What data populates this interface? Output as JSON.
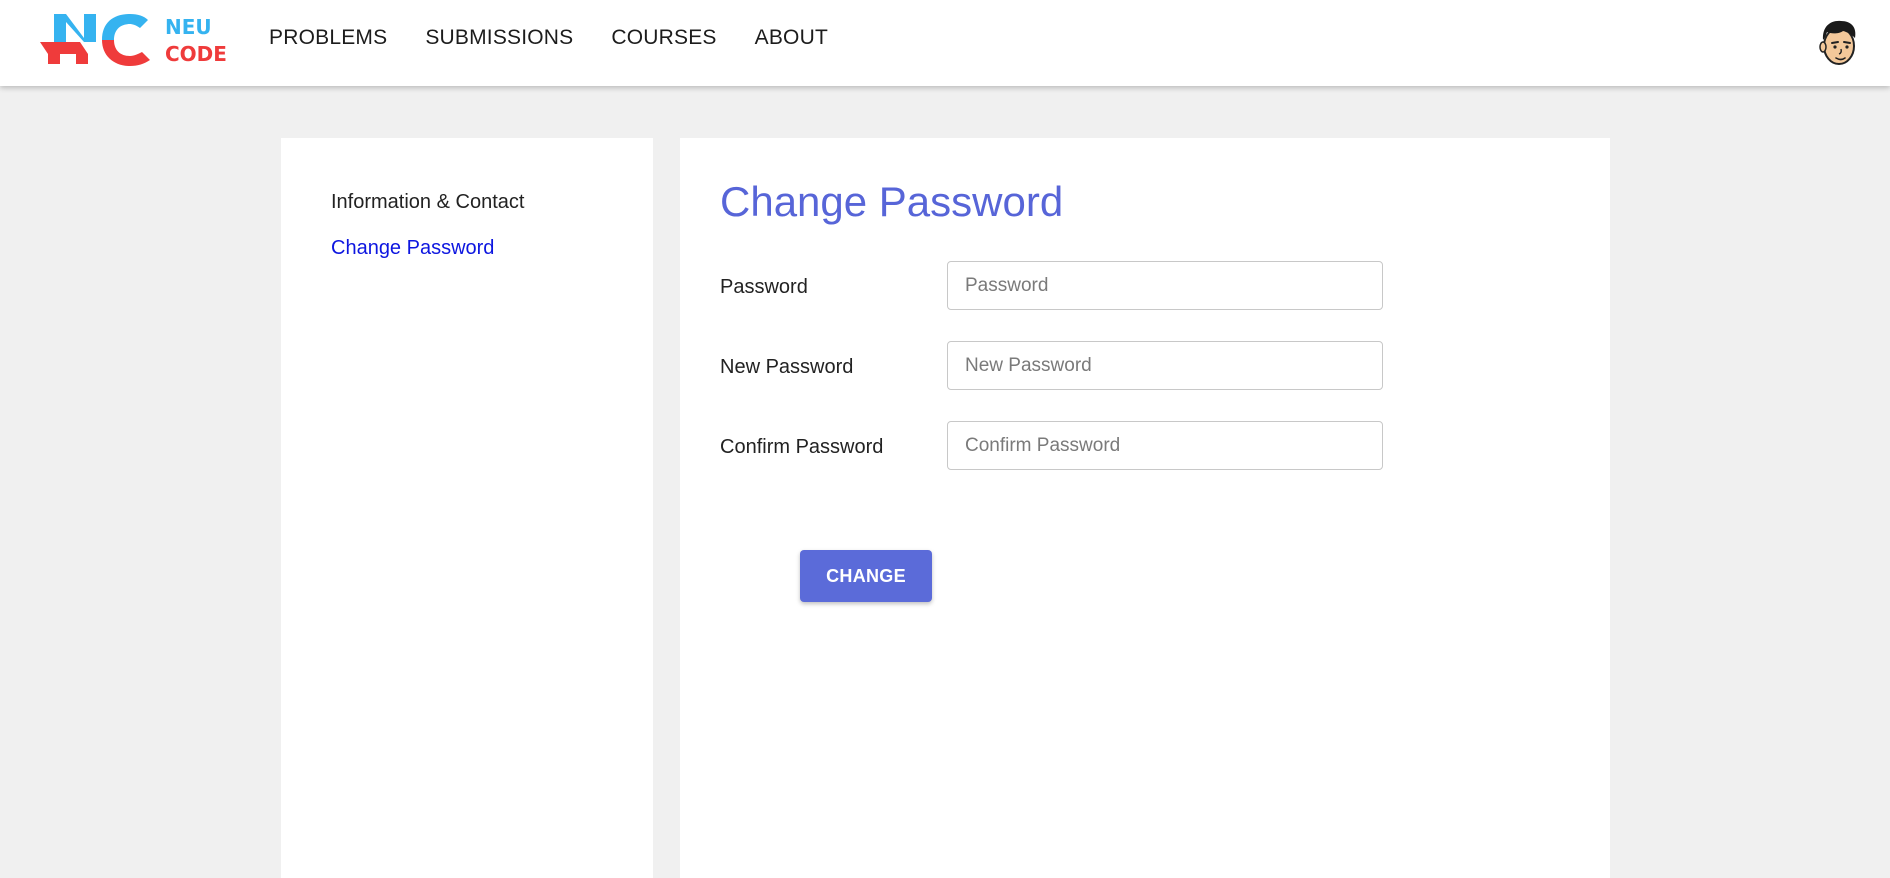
{
  "brand": {
    "line1": "NEU",
    "line2": "CODE",
    "mark_colors": {
      "blue": "#35b3f0",
      "red": "#ef3b3b"
    }
  },
  "nav": {
    "items": [
      {
        "label": "PROBLEMS"
      },
      {
        "label": "SUBMISSIONS"
      },
      {
        "label": "COURSES"
      },
      {
        "label": "ABOUT"
      }
    ],
    "avatar_icon": "user-avatar-icon"
  },
  "sidebar": {
    "items": [
      {
        "label": "Information & Contact",
        "active": false
      },
      {
        "label": "Change Password",
        "active": true
      }
    ],
    "active_color": "#0d16e0"
  },
  "main": {
    "title": "Change Password",
    "accent_color": "#5765d8",
    "fields": [
      {
        "label": "Password",
        "placeholder": "Password",
        "value": ""
      },
      {
        "label": "New Password",
        "placeholder": "New Password",
        "value": ""
      },
      {
        "label": "Confirm Password",
        "placeholder": "Confirm Password",
        "value": ""
      }
    ],
    "submit_label": "CHANGE",
    "button_color": "#5b6bd9"
  }
}
